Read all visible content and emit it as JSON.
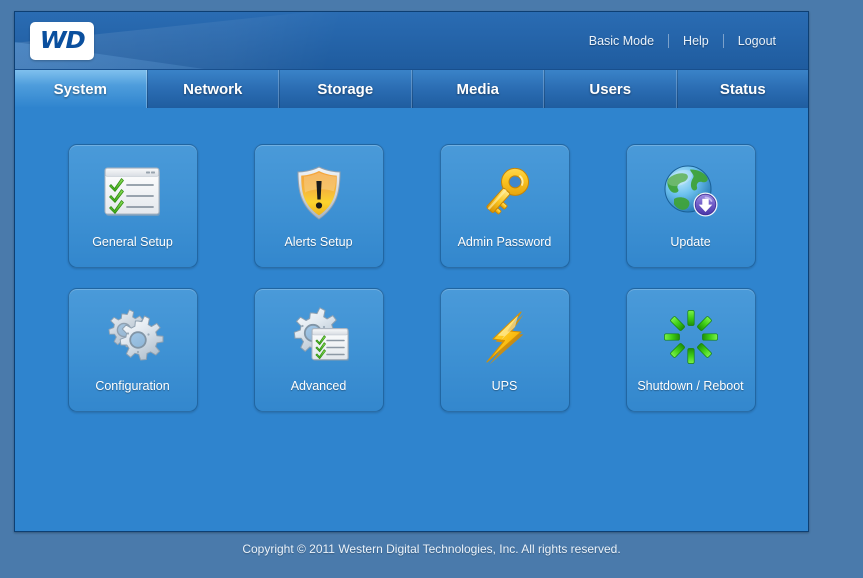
{
  "app": {
    "brand_logo_text": "WD",
    "accent_color": "#2f84ce",
    "header_color": "#2463a8",
    "page_background": "#4a7aab"
  },
  "header": {
    "links": [
      {
        "label": "Basic Mode",
        "name": "basic-mode-link"
      },
      {
        "label": "Help",
        "name": "help-link"
      },
      {
        "label": "Logout",
        "name": "logout-link"
      }
    ]
  },
  "tabs": [
    {
      "label": "System",
      "active": true
    },
    {
      "label": "Network",
      "active": false
    },
    {
      "label": "Storage",
      "active": false
    },
    {
      "label": "Media",
      "active": false
    },
    {
      "label": "Users",
      "active": false
    },
    {
      "label": "Status",
      "active": false
    }
  ],
  "main": {
    "tiles": [
      {
        "label": "General Setup",
        "icon": "checklist-window-icon"
      },
      {
        "label": "Alerts Setup",
        "icon": "warning-shield-icon"
      },
      {
        "label": "Admin Password",
        "icon": "key-icon"
      },
      {
        "label": "Update",
        "icon": "globe-download-icon"
      },
      {
        "label": "Configuration",
        "icon": "gears-icon"
      },
      {
        "label": "Advanced",
        "icon": "gear-checklist-icon"
      },
      {
        "label": "UPS",
        "icon": "lightning-bolt-icon"
      },
      {
        "label": "Shutdown / Reboot",
        "icon": "power-spinner-icon"
      }
    ]
  },
  "footer": {
    "copyright": "Copyright © 2011 Western Digital Technologies, Inc. All rights reserved."
  }
}
